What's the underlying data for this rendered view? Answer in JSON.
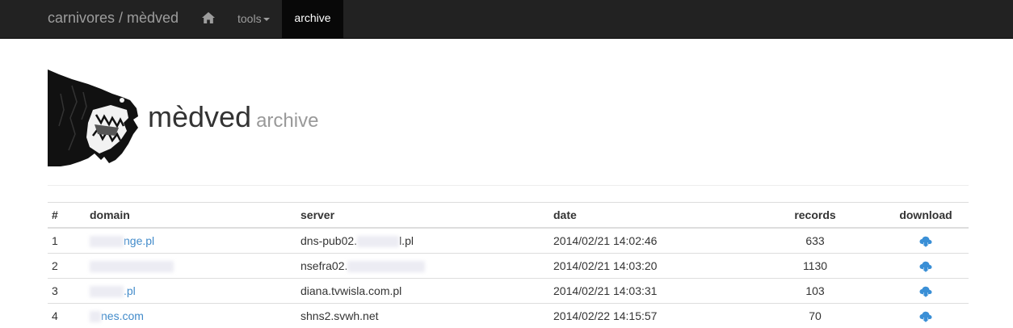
{
  "nav": {
    "brand": "carnivores / mèdved",
    "tools_label": "tools",
    "archive_label": "archive",
    "home_icon": "home-icon"
  },
  "header": {
    "title": "mèdved",
    "subtitle": "archive",
    "logo_icon": "snarling-wolf-logo"
  },
  "table": {
    "columns": [
      "#",
      "domain",
      "server",
      "date",
      "records",
      "download"
    ],
    "rows": [
      {
        "num": "1",
        "domain": "nge.pl",
        "server": "dns-pub02.",
        "server_tail": "l.pl",
        "date": "2014/02/21 14:02:46",
        "records": "633"
      },
      {
        "num": "2",
        "domain": "",
        "server": "nsefra02.",
        "server_tail": "",
        "date": "2014/02/21 14:03:20",
        "records": "1130"
      },
      {
        "num": "3",
        "domain": ".pl",
        "server": "diana.tvwisla.com.pl",
        "server_tail": "",
        "date": "2014/02/21 14:03:31",
        "records": "103"
      },
      {
        "num": "4",
        "domain": "nes.com",
        "server": "shns2.svwh.net",
        "server_tail": "",
        "date": "2014/02/22 14:15:57",
        "records": "70"
      }
    ]
  },
  "colors": {
    "navbar": "#222222",
    "active_tab": "#080808",
    "link": "#428bca",
    "download_icon": "#3a8fd6"
  }
}
